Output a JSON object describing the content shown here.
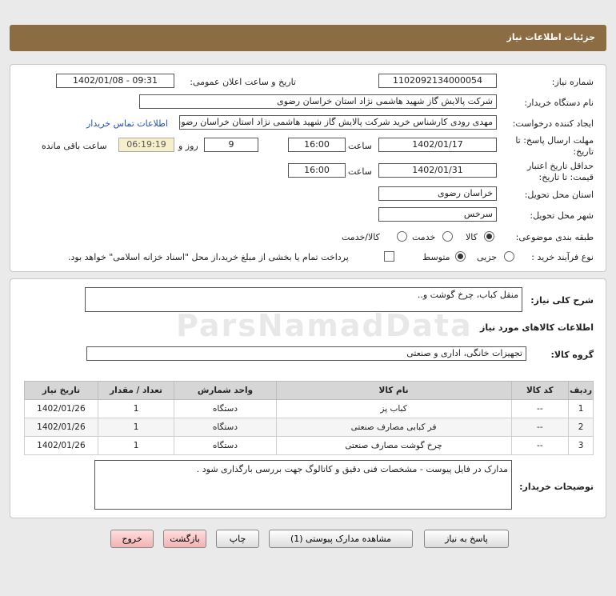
{
  "header": {
    "title": "جزئیات اطلاعات نیاز"
  },
  "form": {
    "need_number_label": "شماره نیاز:",
    "need_number": "1102092134000054",
    "announce_label": "تاریخ و ساعت اعلان عمومی:",
    "announce_value": "1402/01/08 - 09:31",
    "buyer_org_label": "نام دستگاه خریدار:",
    "buyer_org": "شرکت پالایش گاز شهید هاشمی نژاد   استان خراسان رضوی",
    "requester_label": "ایجاد کننده درخواست:",
    "requester": "مهدی رودی کارشناس خرید شرکت پالایش گاز شهید هاشمی نژاد   استان خراسان رضوی",
    "contact_link": "اطلاعات تماس خریدار",
    "reply_deadline_label_1": "مهلت ارسال پاسخ: تا",
    "reply_deadline_label_2": "تاریخ:",
    "reply_date": "1402/01/17",
    "time_label": "ساعت",
    "reply_time": "16:00",
    "days_value": "9",
    "days_label": "روز و",
    "remaining_time": "06:19:19",
    "remaining_label": "ساعت باقی مانده",
    "price_validity_label_1": "حداقل تاریخ اعتبار",
    "price_validity_label_2": "قیمت: تا تاریخ:",
    "validity_date": "1402/01/31",
    "validity_time": "16:00",
    "delivery_province_label": "استان محل تحویل:",
    "delivery_province": "خراسان رضوی",
    "delivery_city_label": "شهر محل تحویل:",
    "delivery_city": "سرخس",
    "category_label": "طبقه بندی موضوعی:",
    "category_options": [
      "کالا",
      "خدمت",
      "کالا/خدمت"
    ],
    "process_label": "نوع فرآیند خرید :",
    "process_options": [
      "جزیی",
      "متوسط"
    ],
    "payment_note": "پرداخت تمام یا بخشی از مبلغ خرید،از محل \"اسناد خزانه اسلامی\" خواهد بود."
  },
  "summary": {
    "description_label": "شرح کلی نیاز:",
    "description": "منقل کباب، چرخ گوشت و..",
    "goods_info_title": "اطلاعات کالاهای مورد نیاز",
    "goods_group_label": "گروه کالا:",
    "goods_group": "تجهیزات خانگی، اداری و صنعتی"
  },
  "table": {
    "headers": [
      "ردیف",
      "کد کالا",
      "نام کالا",
      "واحد شمارش",
      "تعداد / مقدار",
      "تاریخ نیاز"
    ],
    "rows": [
      [
        "1",
        "--",
        "کباب پز",
        "دستگاه",
        "1",
        "1402/01/26"
      ],
      [
        "2",
        "--",
        "فر کبابی مصارف صنعتی",
        "دستگاه",
        "1",
        "1402/01/26"
      ],
      [
        "3",
        "--",
        "چرخ گوشت مصارف صنعتی",
        "دستگاه",
        "1",
        "1402/01/26"
      ]
    ]
  },
  "buyer_notes": {
    "label": "توضیحات خریدار:",
    "text": "مدارک در فایل پیوست - مشخصات فنی دقیق و کاتالوگ جهت بررسی  بارگذاری شود ."
  },
  "buttons": {
    "reply": "پاسخ به نیاز",
    "view_docs": "مشاهده مدارک پیوستی (1)",
    "print": "چاپ",
    "back": "بازگشت",
    "exit": "خروج"
  },
  "watermark": "ParsNamadData"
}
